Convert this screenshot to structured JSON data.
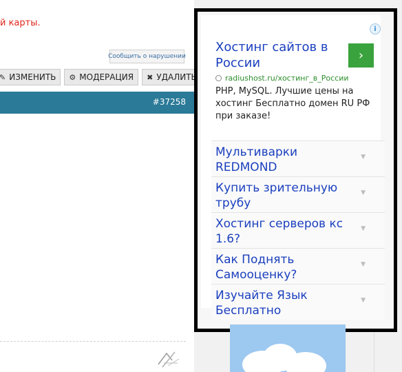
{
  "post": {
    "text_fragment": "й карты.",
    "report_label": "Сообщить о нарушении",
    "actions": [
      {
        "icon": "pencil-icon",
        "label": "ИЗМЕНИТЬ"
      },
      {
        "icon": "gear-icon",
        "label": "МОДЕРАЦИЯ"
      },
      {
        "icon": "close-icon",
        "label": "УДАЛИТЬ"
      }
    ],
    "post_id": "#37258"
  },
  "ad": {
    "info_glyph": "i",
    "title": "Хостинг сайтов в России",
    "go_glyph": "›",
    "url": "radiushost.ru/хостинг_в_России",
    "description": "PHP, MySQL. Лучшие цены на хостинг Бесплатно домен RU РФ при заказе!",
    "links": [
      {
        "label": "Мультиварки REDMOND"
      },
      {
        "label": "Купить зрительную трубу"
      },
      {
        "label": "Хостинг серверов кс 1.6?"
      },
      {
        "label": "Как Поднять Самооценку?"
      },
      {
        "label": "Изучайте Язык Бесплатно"
      }
    ]
  },
  "colors": {
    "bar": "#2b7a98",
    "ad_link": "#1a3fbe",
    "ad_go": "#3aa33d",
    "alert_text": "#e0261b"
  }
}
